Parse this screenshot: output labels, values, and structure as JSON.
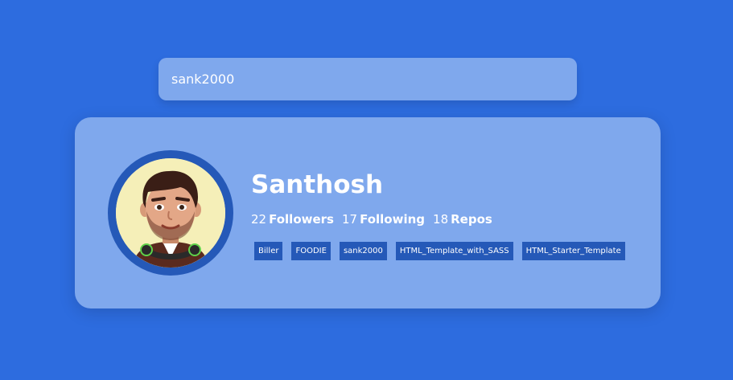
{
  "search": {
    "value": "sank2000"
  },
  "profile": {
    "name": "Santhosh",
    "followers_count": "22",
    "followers_label": "Followers",
    "following_count": "17",
    "following_label": "Following",
    "repos_count": "18",
    "repos_label": "Repos",
    "avatar_icon": "cartoon-avatar-icon"
  },
  "repos": [
    "Biller",
    "FOODIE",
    "sank2000",
    "HTML_Template_with_SASS",
    "HTML_Starter_Template"
  ],
  "colors": {
    "background": "#2d6cdf",
    "card": "#7fa8ed",
    "accent": "#2559b8"
  }
}
